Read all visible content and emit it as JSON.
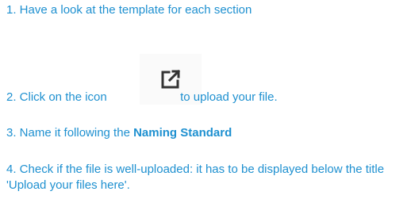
{
  "steps": {
    "step1": "1. Have a look at the template for each section",
    "step2_before": "2. Click on the icon ",
    "step2_after": " to upload your file.",
    "step3_before": "3. Name it following the ",
    "step3_bold": "Naming Standard",
    "step4": "4. Check if the file is well-uploaded: it has to be displayed below the title 'Upload your files here'."
  },
  "icon": {
    "name": "open-external-icon",
    "color": "#333333"
  },
  "colors": {
    "text": "#1e90d0",
    "icon_background": "#fafafa"
  }
}
